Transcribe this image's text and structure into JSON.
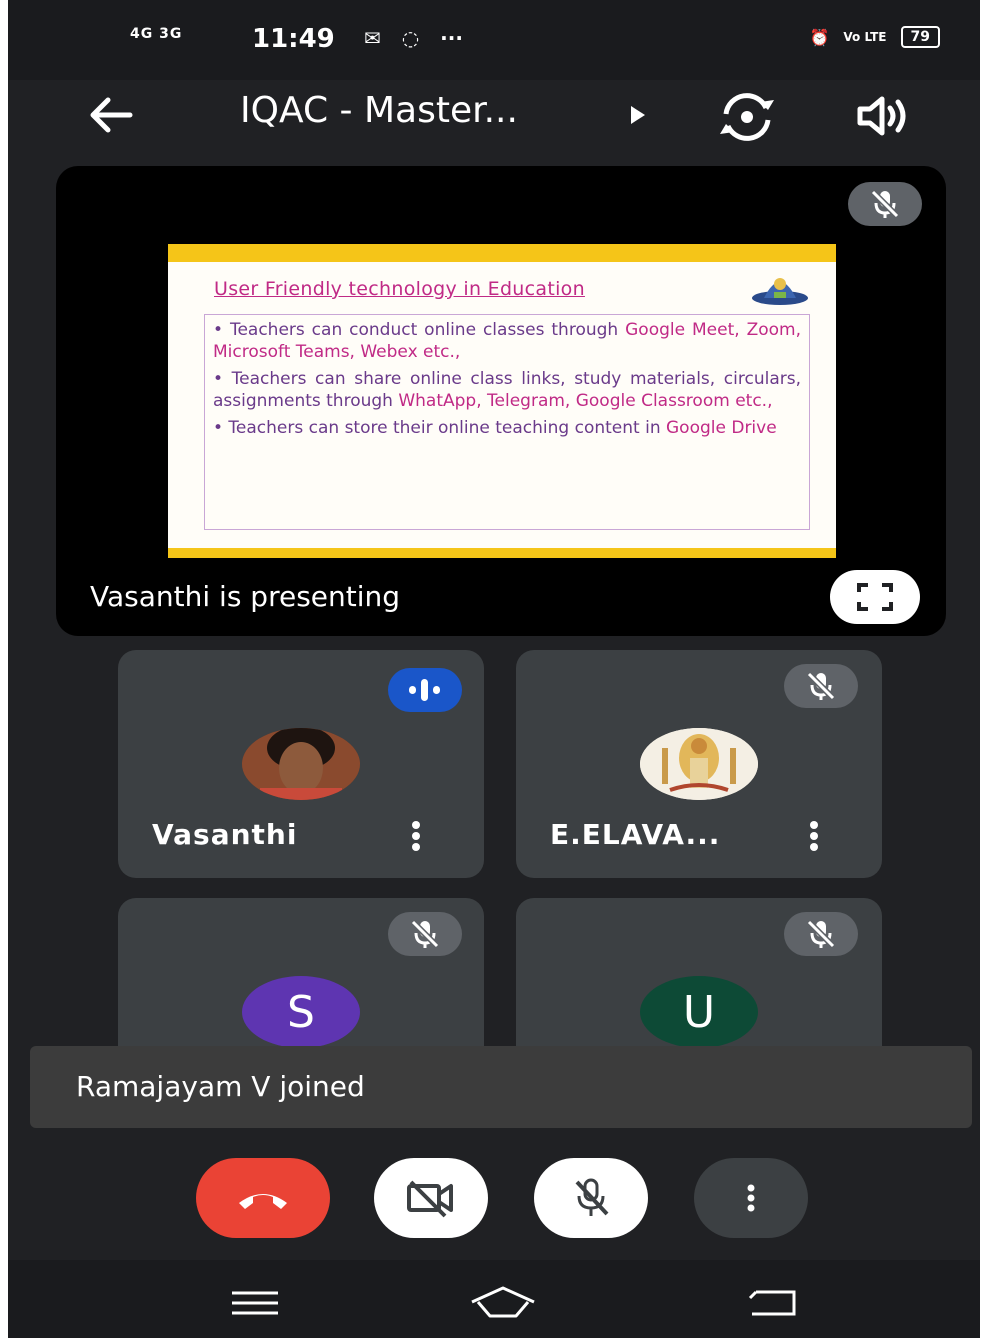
{
  "status_bar": {
    "network": "4G 3G",
    "time": "11:49",
    "battery": "79"
  },
  "app_bar": {
    "title": "IQAC - Master..."
  },
  "presentation": {
    "slide_title": "User Friendly technology in Education",
    "bullets": [
      {
        "plain": "• Teachers can conduct online classes through ",
        "highlight": "Google Meet, Zoom, Microsoft Teams, Webex",
        "tail": " etc.,"
      },
      {
        "plain": "• Teachers can share online class links, study materials, circulars, assignments through ",
        "highlight": "WhatApp, Telegram, Google Classroom",
        "tail": " etc.,"
      },
      {
        "plain": "• Teachers can store their online teaching content in ",
        "highlight": "Google Drive",
        "tail": ""
      }
    ],
    "status_text": "Vasanthi is presenting"
  },
  "participants": [
    {
      "name": "Vasanthi",
      "speaking": true
    },
    {
      "name": "E.ELAVA...",
      "speaking": false
    },
    {
      "name": "",
      "initial": "S",
      "color": "#5e35b1",
      "speaking": false
    },
    {
      "name": "",
      "initial": "U",
      "color": "#0d4a36",
      "speaking": false
    }
  ],
  "toast": {
    "message": "Ramajayam V joined"
  },
  "colors": {
    "end_call": "#ea4335",
    "speaking": "#1a56c9",
    "tile_bg": "#3c4043",
    "app_bg": "#202124"
  }
}
